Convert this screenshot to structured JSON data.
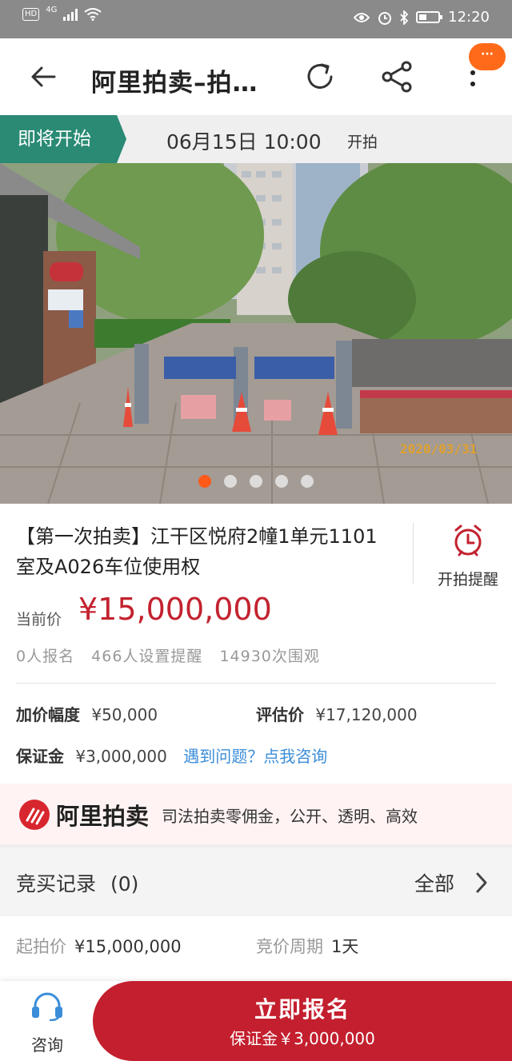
{
  "status_bar": {
    "network_badge": "HD",
    "network_type": "4G",
    "time": "12:20"
  },
  "nav": {
    "title": "阿里拍卖–拍…",
    "more_badge": "···"
  },
  "banner": {
    "tag": "即将开始",
    "datetime": "06月15日 10:00",
    "suffix": "开拍"
  },
  "photo": {
    "date_stamp": "2020/03/31",
    "slide_count": 5,
    "active_slide": 1
  },
  "lot": {
    "title": "【第一次拍卖】江干区悦府2幢1单元1101室及A026车位使用权",
    "remind_label": "开拍提醒",
    "price_label": "当前价",
    "price_value": "¥15,000,000",
    "stats": {
      "signups": "0人报名",
      "reminders": "466人设置提醒",
      "views": "14930次围观"
    },
    "increment_label": "加价幅度",
    "increment_value": "¥50,000",
    "appraisal_label": "评估价",
    "appraisal_value": "¥17,120,000",
    "deposit_label": "保证金",
    "deposit_value": "¥3,000,000",
    "consult_link": "遇到问题？点我咨询"
  },
  "promo": {
    "brand": "阿里拍卖",
    "text": "司法拍卖零佣金，公开、透明、高效"
  },
  "records": {
    "title": "竞买记录",
    "count": "(0)",
    "all_label": "全部"
  },
  "details": {
    "start_price_label": "起拍价",
    "start_price_value": "¥15,000,000",
    "cycle_label": "竞价周期",
    "cycle_value": "1天"
  },
  "bottom": {
    "consult_label": "咨询",
    "signup_title": "立即报名",
    "signup_sub": "保证金￥3,000,000"
  },
  "colors": {
    "brand_red": "#c41f2e",
    "price_red": "#c3222f",
    "banner_green": "#2a8a74",
    "link_blue": "#3b8dd8",
    "active_dot": "#ff5a1a"
  }
}
